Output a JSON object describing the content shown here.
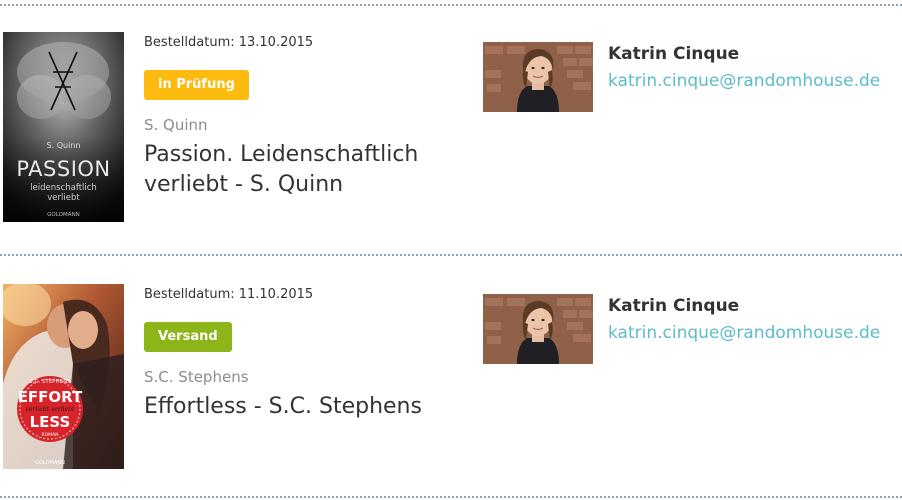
{
  "orders": [
    {
      "date_label": "Bestelldatum: 13.10.2015",
      "status": "in Prüfung",
      "status_color": "#fdbb0f",
      "author": "S. Quinn",
      "title": "Passion. Leidenschaftlich verliebt - S. Quinn",
      "cover": {
        "author_text": "S. Quinn",
        "title_text": "PASSION",
        "subtitle_line1": "leidenschaftlich",
        "subtitle_line2": "verliebt",
        "publisher": "GOLDMANN"
      },
      "contact": {
        "name": "Katrin Cinque",
        "email": "katrin.cinque@randomhouse.de"
      }
    },
    {
      "date_label": "Bestelldatum: 11.10.2015",
      "status": "Versand",
      "status_color": "#8cb51a",
      "author": "S.C. Stephens",
      "title": "Effortless - S.C. Stephens",
      "cover": {
        "author_text": "S.C. STEPHENS",
        "title_line1": "EFFORT",
        "subtitle": "verliebt verliebt",
        "title_line2": "LESS",
        "genre": "ROMAN",
        "publisher": "GOLDMANN"
      },
      "contact": {
        "name": "Katrin Cinque",
        "email": "katrin.cinque@randomhouse.de"
      }
    }
  ],
  "colors": {
    "divider": "#8fa3b3",
    "email_link": "#5bbdc9",
    "author_gray": "#8c8c8c",
    "text_dark": "#333333"
  }
}
